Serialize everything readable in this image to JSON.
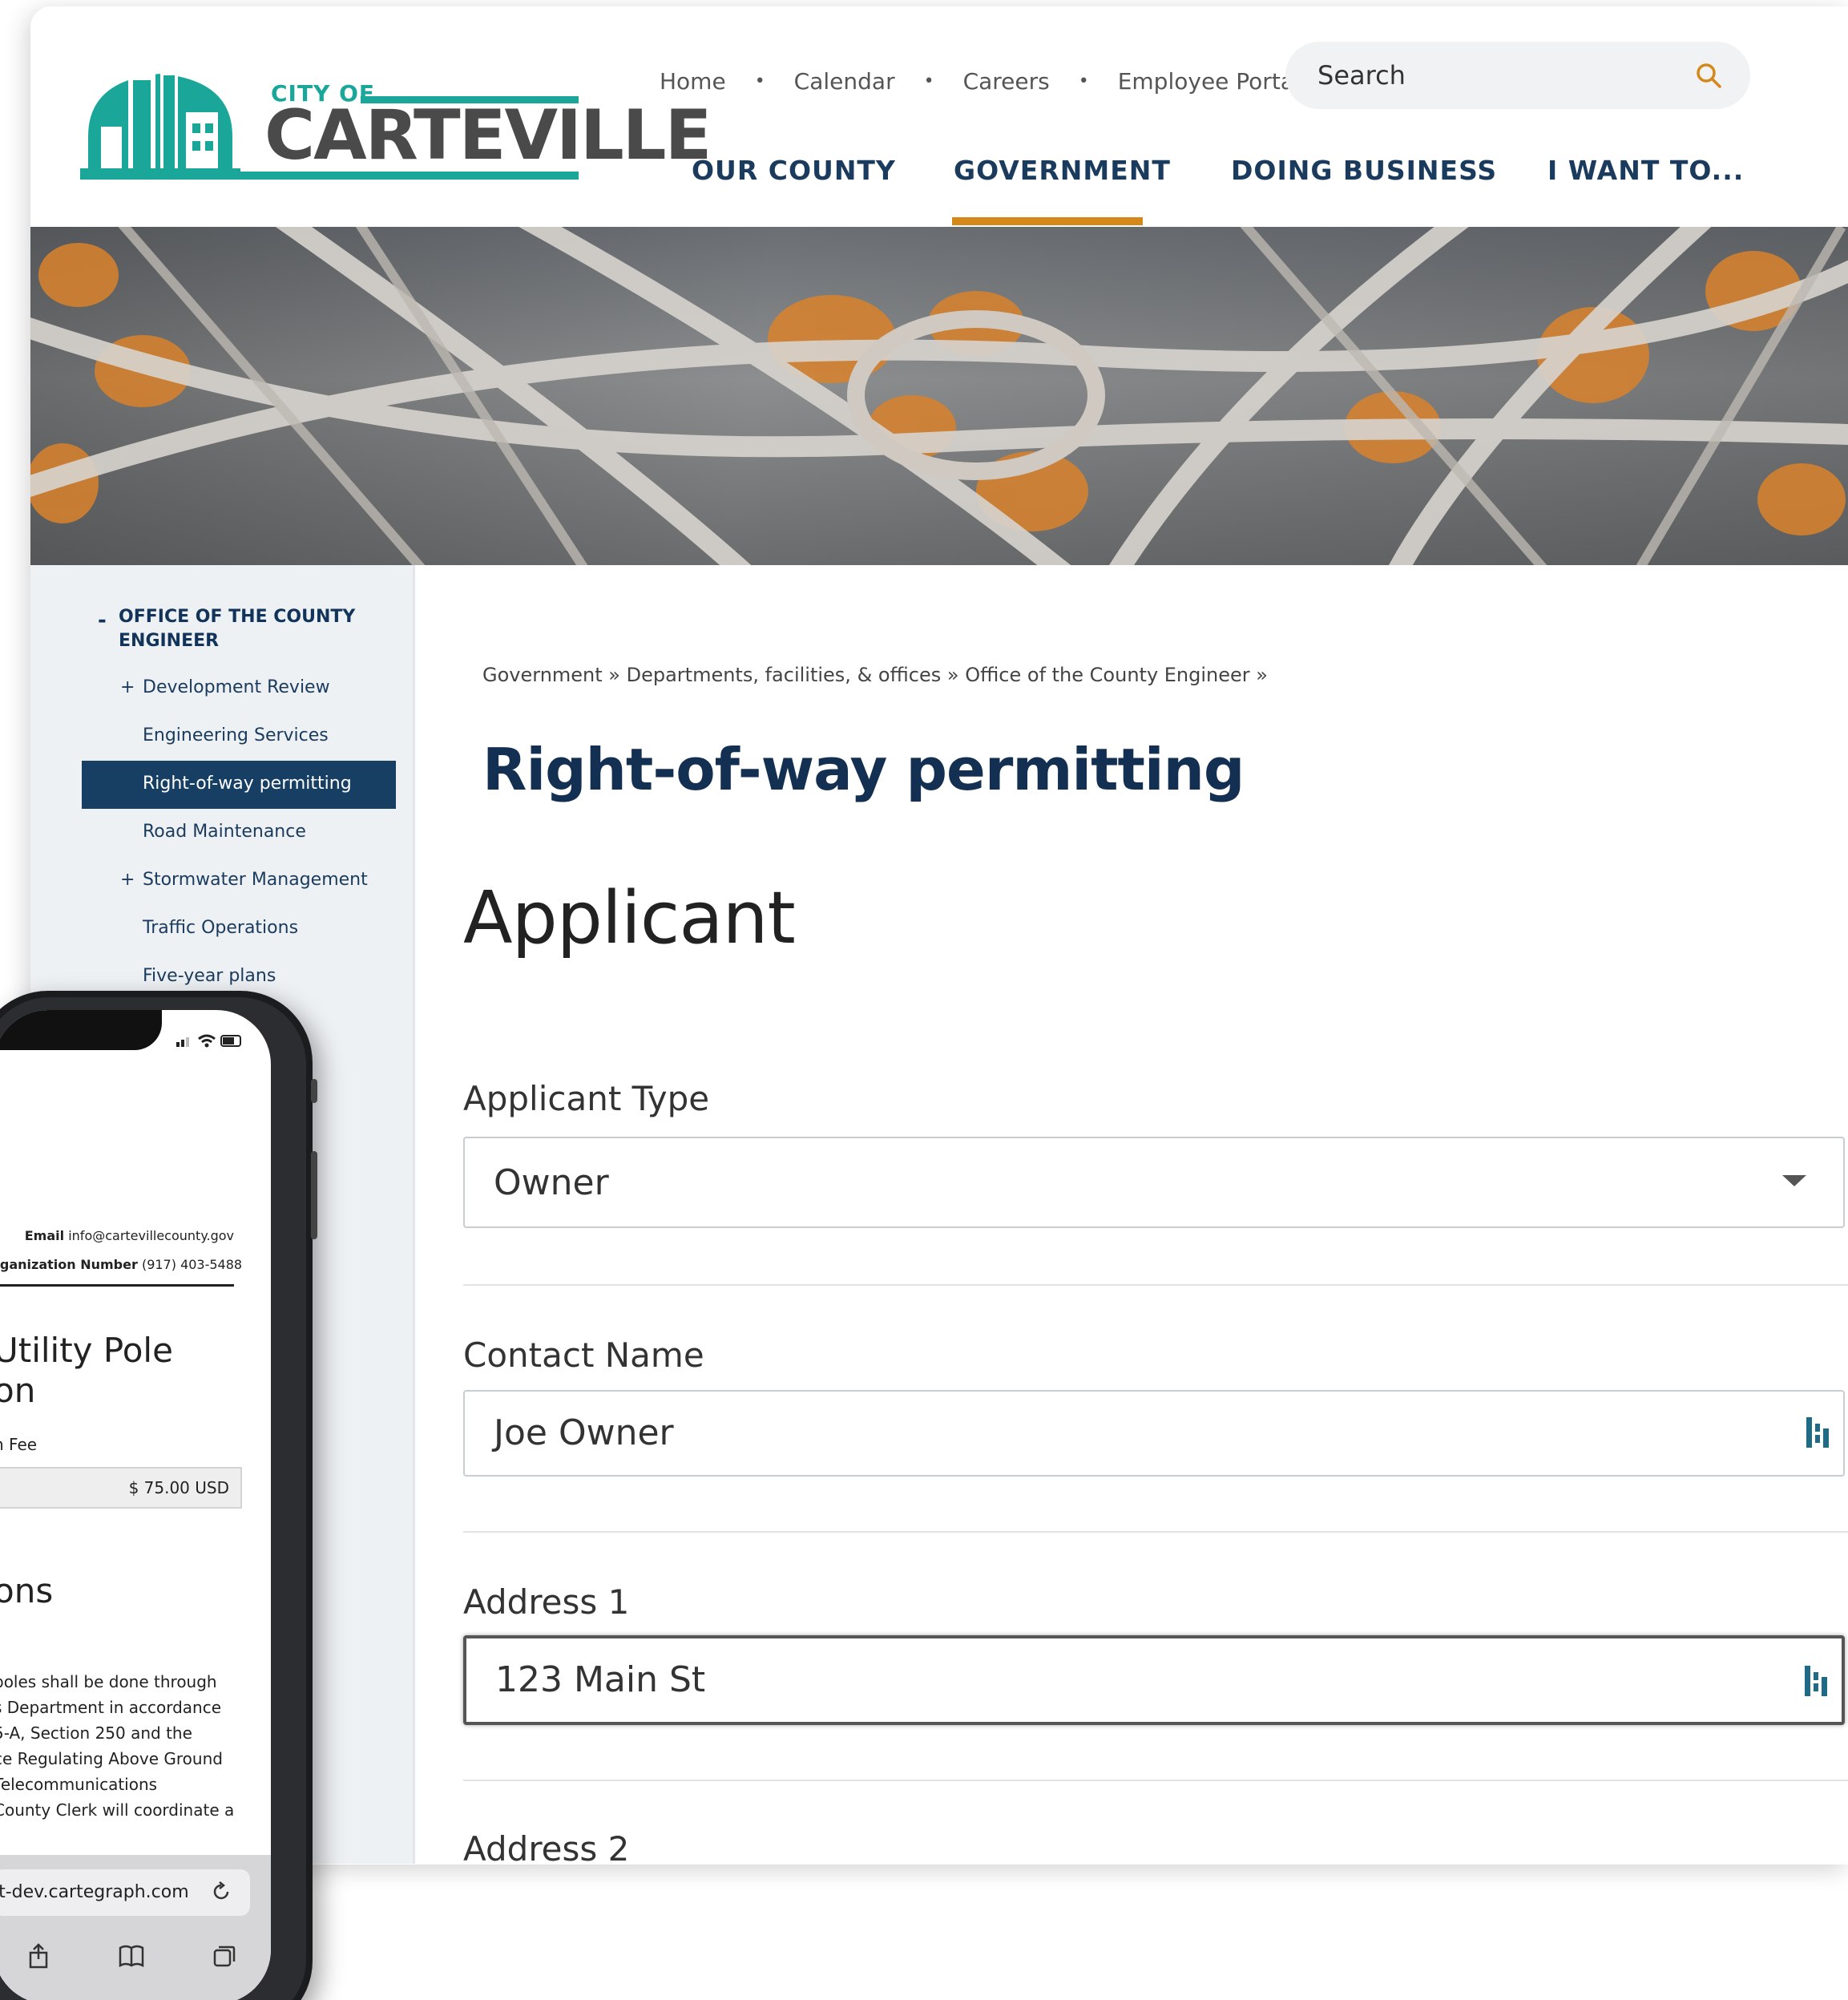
{
  "site": {
    "logo_cityof": "CITY OF",
    "logo_name": "CARTEVILLE",
    "brand_color": "#1aa79a",
    "nav_color": "#1a3b5d",
    "accent_color": "#d5881a"
  },
  "utility_nav": [
    "Home",
    "Calendar",
    "Careers",
    "Employee Portal"
  ],
  "search": {
    "placeholder": "Search",
    "icon": "search-icon"
  },
  "main_nav": [
    {
      "label": "OUR COUNTY"
    },
    {
      "label": "GOVERNMENT",
      "active": true
    },
    {
      "label": "DOING BUSINESS"
    },
    {
      "label": "I WANT TO..."
    }
  ],
  "sidebar": {
    "heading": "OFFICE OF THE COUNTY ENGINEER",
    "items": [
      {
        "label": "Development Review",
        "expandable": true
      },
      {
        "label": "Engineering Services"
      },
      {
        "label": "Right-of-way permitting",
        "active": true
      },
      {
        "label": "Road Maintenance"
      },
      {
        "label": "Stormwater Management",
        "expandable": true
      },
      {
        "label": "Traffic Operations"
      },
      {
        "label": "Five-year plans"
      }
    ]
  },
  "breadcrumb": "Government » Departments, facilities, & offices » Office of the County Engineer »",
  "page_title": "Right-of-way permitting",
  "form": {
    "section_title": "Applicant",
    "fields": [
      {
        "label": "Applicant Type",
        "value": "Owner",
        "kind": "select"
      },
      {
        "label": "Contact Name",
        "value": "Joe Owner",
        "kind": "text"
      },
      {
        "label": "Address 1",
        "value": "123 Main St",
        "kind": "text",
        "focused": true
      },
      {
        "label": "Address 2",
        "value": "",
        "kind": "text"
      }
    ]
  },
  "phone": {
    "email_label": "Email",
    "email_value": "info@cartevillecounty.gov",
    "org_label": "rganization Number",
    "org_value": "(917) 403-5488",
    "heading_line1": "Utility Pole",
    "heading_line2": "on",
    "fee_label": "n Fee",
    "fee_value": "$ 75.00 USD",
    "section2": "ons",
    "body_lines": [
      "poles shall be done through",
      "s Department in accordance",
      "5-A, Section 250 and the",
      "ce Regulating Above Ground",
      "Telecommunications",
      "County Clerk will coordinate a"
    ],
    "url": "it-dev.cartegraph.com"
  }
}
